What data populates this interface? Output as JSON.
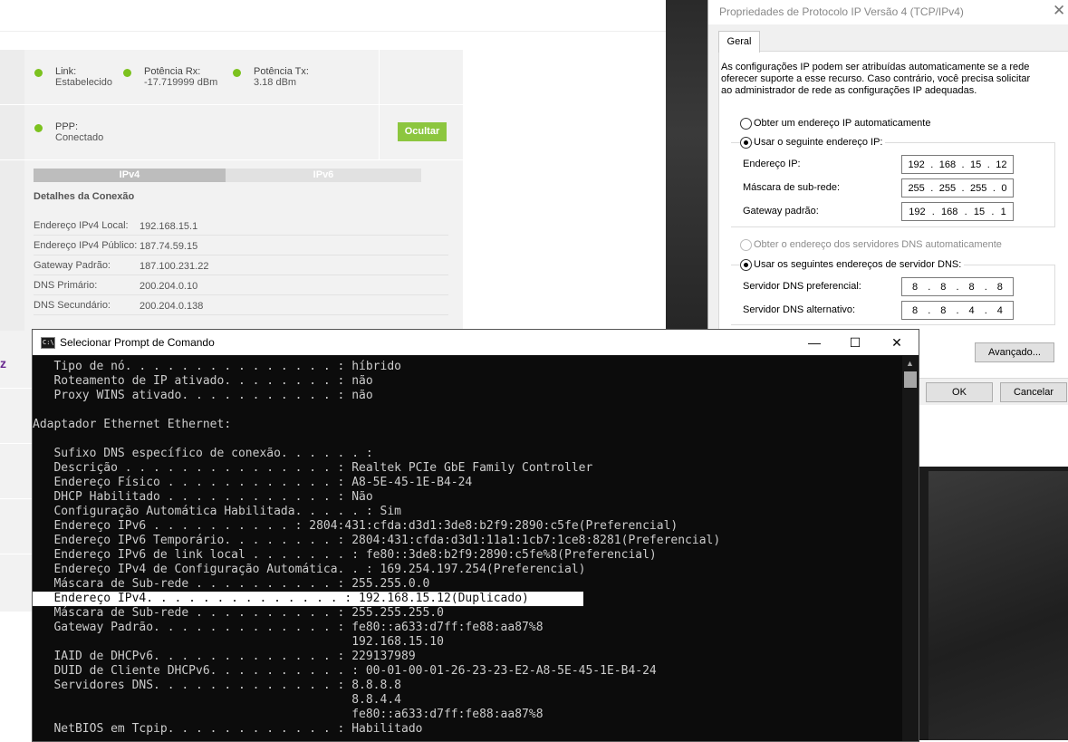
{
  "router": {
    "stats": [
      {
        "label": "Link:",
        "value": "Estabelecido"
      },
      {
        "label": "Potência Rx:",
        "value": "-17.719999 dBm"
      },
      {
        "label": "Potência Tx:",
        "value": "3.18 dBm"
      }
    ],
    "ppp": {
      "label": "PPP:",
      "value": "Conectado"
    },
    "hide_button": "Ocultar",
    "tabs": {
      "ipv4": "IPv4",
      "ipv6": "IPv6"
    },
    "details_title": "Detalhes da Conexão",
    "details": [
      {
        "key": "Endereço IPv4 Local:",
        "value": "192.168.15.1"
      },
      {
        "key": "Endereço IPv4 Público:",
        "value": "187.74.59.15"
      },
      {
        "key": "Gateway Padrão:",
        "value": "187.100.231.22"
      },
      {
        "key": "DNS Primário:",
        "value": "200.204.0.10"
      },
      {
        "key": "DNS Secundário:",
        "value": "200.204.0.138"
      }
    ],
    "side_letter": "z",
    "status_color": "#7cc21f",
    "button_color": "#8cc63f"
  },
  "dialog": {
    "title": "Propriedades de Protocolo IP Versão 4 (TCP/IPv4)",
    "close": "✕",
    "tab": "Geral",
    "description": "As configurações IP podem ser atribuídas automaticamente se a rede oferecer suporte a esse recurso. Caso contrário, você precisa solicitar ao administrador de rede as configurações IP adequadas.",
    "radio_auto_ip": "Obter um endereço IP automaticamente",
    "radio_manual_ip": "Usar o seguinte endereço IP:",
    "ip_label": "Endereço IP:",
    "ip_value": [
      "192",
      "168",
      "15",
      "12"
    ],
    "mask_label": "Máscara de sub-rede:",
    "mask_value": [
      "255",
      "255",
      "255",
      "0"
    ],
    "gateway_label": "Gateway padrão:",
    "gateway_value": [
      "192",
      "168",
      "15",
      "1"
    ],
    "radio_auto_dns": "Obter o endereço dos servidores DNS automaticamente",
    "radio_manual_dns": "Usar os seguintes endereços de servidor DNS:",
    "dns_pref_label": "Servidor DNS preferencial:",
    "dns_pref_value": [
      "8",
      "8",
      "8",
      "8"
    ],
    "dns_alt_label": "Servidor DNS alternativo:",
    "dns_alt_value": [
      "8",
      "8",
      "4",
      "4"
    ],
    "advanced_button": "Avançado...",
    "ok_button": "OK",
    "cancel_button": "Cancelar"
  },
  "cmd": {
    "title": "Selecionar Prompt de Comando",
    "icon_text": "C:\\",
    "minimize": "—",
    "maximize": "☐",
    "close": "✕",
    "lines": [
      "   Tipo de nó. . . . . . . . . . . . . . . : híbrido",
      "   Roteamento de IP ativado. . . . . . . . : não",
      "   Proxy WINS ativado. . . . . . . . . . . : não",
      "",
      "Adaptador Ethernet Ethernet:",
      "",
      "   Sufixo DNS específico de conexão. . . . . . :",
      "   Descrição . . . . . . . . . . . . . . . : Realtek PCIe GbE Family Controller",
      "   Endereço Físico . . . . . . . . . . . . : A8-5E-45-1E-B4-24",
      "   DHCP Habilitado . . . . . . . . . . . . : Não",
      "   Configuração Automática Habilitada. . . . . : Sim",
      "   Endereço IPv6 . . . . . . . . . . : 2804:431:cfda:d3d1:3de8:b2f9:2890:c5fe(Preferencial)",
      "   Endereço IPv6 Temporário. . . . . . . . : 2804:431:cfda:d3d1:11a1:1cb7:1ce8:8281(Preferencial)",
      "   Endereço IPv6 de link local . . . . . . . : fe80::3de8:b2f9:2890:c5fe%8(Preferencial)",
      "   Endereço IPv4 de Configuração Automática. . : 169.254.197.254(Preferencial)",
      "   Máscara de Sub-rede . . . . . . . . . . : 255.255.0.0",
      "   Endereço IPv4. . . . . . . . . . . . . . : 192.168.15.12(Duplicado)",
      "   Máscara de Sub-rede . . . . . . . . . . : 255.255.255.0",
      "   Gateway Padrão. . . . . . . . . . . . . : fe80::a633:d7ff:fe88:aa87%8",
      "                                             192.168.15.10",
      "   IAID de DHCPv6. . . . . . . . . . . . . : 229137989",
      "   DUID de Cliente DHCPv6. . . . . . . . . . : 00-01-00-01-26-23-23-E2-A8-5E-45-1E-B4-24",
      "   Servidores DNS. . . . . . . . . . . . . : 8.8.8.8",
      "                                             8.8.4.4",
      "                                             fe80::a633:d7ff:fe88:aa87%8",
      "   NetBIOS em Tcpip. . . . . . . . . . . . : Habilitado"
    ],
    "highlighted_line": 16
  }
}
